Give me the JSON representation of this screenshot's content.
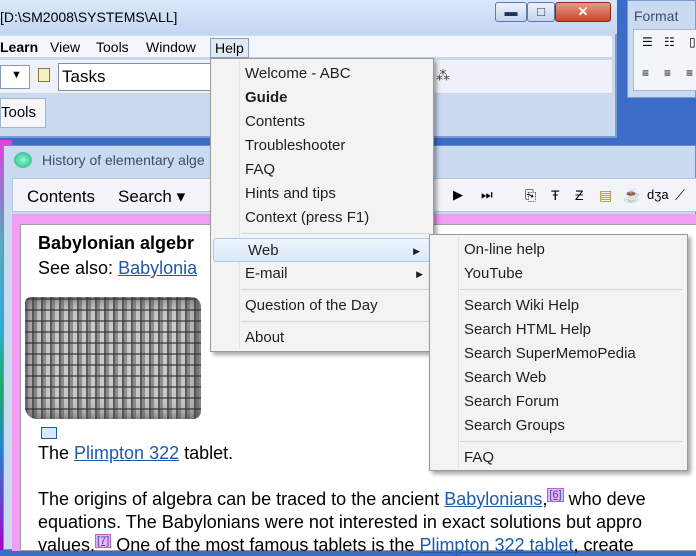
{
  "main_window": {
    "title": "[D:\\SM2008\\SYSTEMS\\ALL]",
    "min_label": "▬",
    "max_label": "□",
    "close_label": "✕"
  },
  "menubar": [
    "Learn",
    "View",
    "Tools",
    "Window",
    "Help"
  ],
  "toolbar": {
    "tasks_value": "Tasks"
  },
  "tools_tab": "Tools",
  "format_panel": {
    "title": "Format"
  },
  "doc_window": {
    "title": "History of elementary alge",
    "toolbar": {
      "contents": "Contents",
      "search": "Search ▾"
    }
  },
  "help_menu": {
    "items": [
      {
        "label": "Welcome - ABC",
        "bold": false,
        "submenu": false
      },
      {
        "label": "Guide",
        "bold": true,
        "submenu": false
      },
      {
        "label": "Contents",
        "bold": false,
        "submenu": false
      },
      {
        "label": "Troubleshooter",
        "bold": false,
        "submenu": false
      },
      {
        "label": "FAQ",
        "bold": false,
        "submenu": false
      },
      {
        "label": "Hints and tips",
        "bold": false,
        "submenu": false
      },
      {
        "label": "Context (press F1)",
        "bold": false,
        "submenu": false
      },
      {
        "label": "Web",
        "bold": false,
        "submenu": true
      },
      {
        "label": "E-mail",
        "bold": false,
        "submenu": true
      },
      {
        "label": "Question of the Day",
        "bold": false,
        "submenu": false
      },
      {
        "label": "About",
        "bold": false,
        "submenu": false
      }
    ]
  },
  "web_submenu": {
    "items": [
      "On-line help",
      "YouTube",
      "Search Wiki Help",
      "Search HTML Help",
      "Search SuperMemoPedia",
      "Search Web",
      "Search Forum",
      "Search Groups",
      "FAQ"
    ]
  },
  "article": {
    "heading": "Babylonian algebr",
    "see_also": "See also: ",
    "see_also_link": "Babylonia",
    "caption_pre": "The ",
    "caption_link": "Plimpton 322",
    "caption_post": " tablet.",
    "p1_a": "The origins of algebra can be traced to the ancient ",
    "p1_link": "Babylonians",
    "p1_cite": "[6]",
    "p1_b": " who deve",
    "p2": "equations. The Babylonians were not interested in exact solutions but appro",
    "p3_a": "values.",
    "p3_cite": "[7]",
    "p3_b": " One of the most famous tablets is the ",
    "p3_link": "Plimpton 322 tablet",
    "p3_c": ", create"
  }
}
